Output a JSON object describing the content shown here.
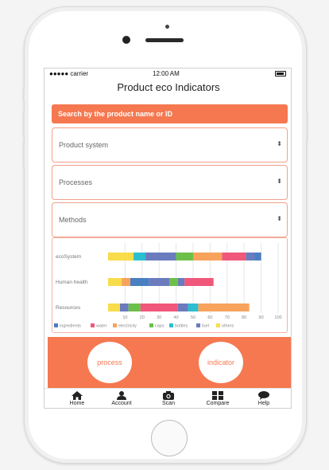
{
  "status_bar": {
    "carrier": "●●●●● carrier",
    "time": "12:00 AM"
  },
  "nav": {
    "title": "Product eco Indicators"
  },
  "search": {
    "placeholder": "Search by the product name or ID"
  },
  "selects": [
    {
      "label": "Product system",
      "arrow": "⬍"
    },
    {
      "label": "Processes",
      "arrow": "⬍"
    },
    {
      "label": "Methods",
      "arrow": "⬍"
    }
  ],
  "chart_data": {
    "type": "bar",
    "orientation": "horizontal",
    "stacked": true,
    "categories": [
      "ecoSystem",
      "Human health",
      "Resources"
    ],
    "xlim": [
      0,
      100
    ],
    "xticks": [
      10,
      20,
      30,
      40,
      50,
      60,
      70,
      80,
      90,
      100
    ],
    "grid": true,
    "legend_position": "bottom",
    "series": [
      {
        "name": "ingredients",
        "color": "#4a7fc1",
        "values": [
          0,
          0,
          0
        ]
      },
      {
        "name": "water",
        "color": "#f0577a",
        "values": [
          0,
          0,
          0
        ]
      },
      {
        "name": "electricity",
        "color": "#f7a35c",
        "values": [
          0,
          0,
          0
        ]
      },
      {
        "name": "caps",
        "color": "#6cc04a",
        "values": [
          0,
          0,
          0
        ]
      },
      {
        "name": "bottles",
        "color": "#2bbfcf",
        "values": [
          0,
          0,
          0
        ]
      },
      {
        "name": "fuel",
        "color": "#6b7bbd",
        "values": [
          0,
          0,
          0
        ]
      },
      {
        "name": "others",
        "color": "#f8dc4a",
        "values": [
          0,
          0,
          0
        ]
      }
    ],
    "stacks": [
      [
        [
          "others",
          15
        ],
        [
          "bottles",
          7
        ],
        [
          "fuel",
          18
        ],
        [
          "caps",
          10
        ],
        [
          "electricity",
          17
        ],
        [
          "water",
          14
        ],
        [
          "fuel",
          5
        ],
        [
          "ingredients",
          4
        ]
      ],
      [
        [
          "others",
          8
        ],
        [
          "electricity",
          5
        ],
        [
          "ingredients",
          11
        ],
        [
          "fuel",
          12
        ],
        [
          "caps",
          5
        ],
        [
          "fuel",
          4
        ],
        [
          "water",
          17
        ]
      ],
      [
        [
          "others",
          7
        ],
        [
          "fuel",
          5
        ],
        [
          "caps",
          7
        ],
        [
          "water",
          22
        ],
        [
          "fuel",
          6
        ],
        [
          "bottles",
          6
        ],
        [
          "electricity",
          30
        ]
      ]
    ]
  },
  "actions": {
    "process": "process",
    "indicator": "indicator"
  },
  "tabs": [
    {
      "label": "Home",
      "icon": "home-icon"
    },
    {
      "label": "Account",
      "icon": "account-icon"
    },
    {
      "label": "Scan",
      "icon": "camera-icon"
    },
    {
      "label": "Compare",
      "icon": "grid-icon"
    },
    {
      "label": "Help",
      "icon": "chat-icon"
    }
  ]
}
